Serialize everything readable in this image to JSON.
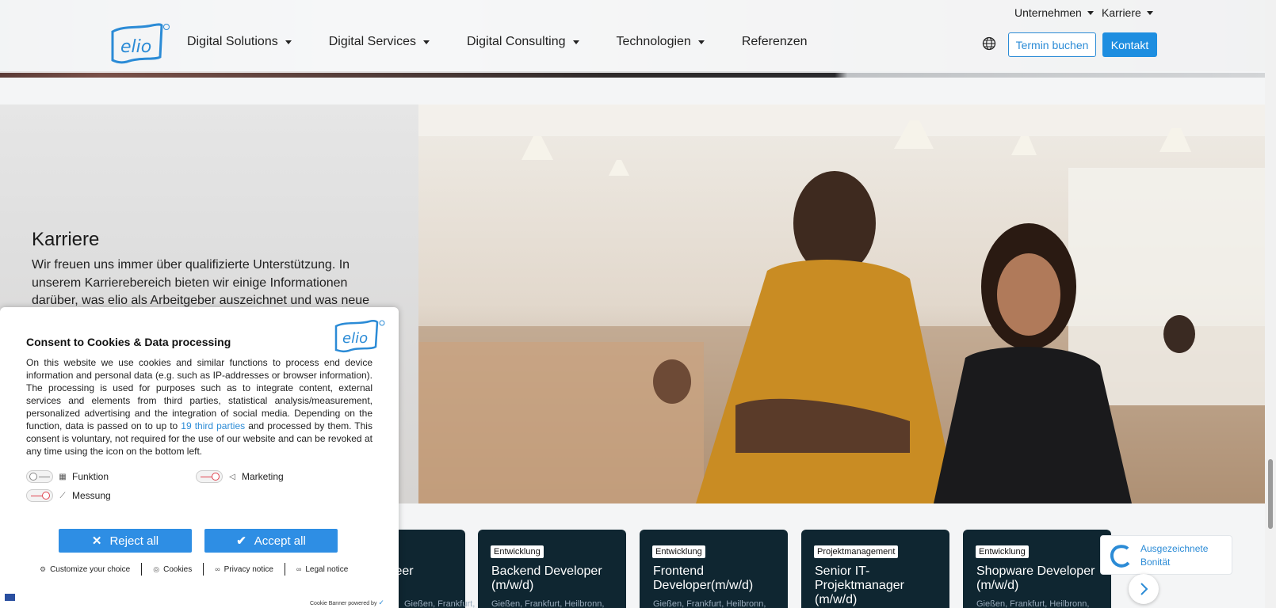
{
  "header": {
    "nav": [
      {
        "label": "Digital Solutions"
      },
      {
        "label": "Digital Services"
      },
      {
        "label": "Digital Consulting"
      },
      {
        "label": "Technologien"
      },
      {
        "label": "Referenzen"
      }
    ],
    "top_links": [
      {
        "label": "Unternehmen"
      },
      {
        "label": "Karriere"
      }
    ],
    "book_button": "Termin buchen",
    "contact_button": "Kontakt"
  },
  "hero": {
    "title": "Karriere",
    "text": "Wir freuen uns immer über qualifizierte Unterstützung. In unserem Karrierebereich bieten wir einige Informationen darüber, was elio als Arbeitgeber auszeichnet und was neue"
  },
  "jobs": [
    {
      "tag": "",
      "title": "ineer",
      "location": "Gießen, Frankfurt, Heilbronn,"
    },
    {
      "tag": "Entwicklung",
      "title": "Backend Developer (m/w/d)",
      "location": "Gießen, Frankfurt, Heilbronn,"
    },
    {
      "tag": "Entwicklung",
      "title": "Frontend Developer(m/w/d)",
      "location": "Gießen, Frankfurt, Heilbronn,"
    },
    {
      "tag": "Projektmanagement",
      "title": "Senior IT-Projektmanager (m/w/d)",
      "location": ""
    },
    {
      "tag": "Entwicklung",
      "title": "Shopware Developer (m/w/d)",
      "location": "Gießen, Frankfurt, Heilbronn,"
    }
  ],
  "badge": {
    "line1": "Ausgezeichnete",
    "line2": "Bonität"
  },
  "consent": {
    "title": "Consent to Cookies & Data processing",
    "body_before_link": "On this website we use cookies and similar functions to process end device information and personal data (e.g. such as IP-addresses or browser information). The processing is used for purposes such as to integrate content, external services and elements from third parties, statistical analysis/measurement, personalized advertising and the integration of social media. Depending on the function, data is passed on to up to",
    "link_text": "19 third parties",
    "body_after_link": "and processed by them. This consent is voluntary, not required for the use of our website and can be revoked at any time using the icon on the bottom left.",
    "toggles": [
      {
        "label": "Funktion"
      },
      {
        "label": "Marketing"
      },
      {
        "label": "Messung"
      }
    ],
    "reject_label": "Reject all",
    "accept_label": "Accept all",
    "links": [
      {
        "label": "Customize your choice"
      },
      {
        "label": "Cookies"
      },
      {
        "label": "Privacy notice"
      },
      {
        "label": "Legal notice"
      }
    ],
    "powered_by": "Cookie Banner powered by"
  },
  "colors": {
    "accent": "#2b8bd6",
    "card_bg": "#0f2631",
    "off_toggle": "#e0434f"
  }
}
